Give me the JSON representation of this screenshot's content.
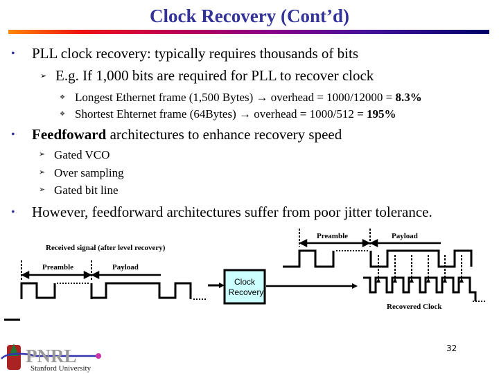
{
  "slide": {
    "title": "Clock Recovery (Cont’d)",
    "page_number": "32"
  },
  "bullets": [
    {
      "text": "PLL clock recovery: typically requires thousands of bits",
      "sub": [
        {
          "text": "E.g. If 1,000 bits are required for PLL to recover clock",
          "sub": [
            {
              "pre": "Longest Ethernet frame (1,500 Bytes) ",
              "arrow": "→",
              "post": " overhead = 1000/12000 = ",
              "bold": "8.3%"
            },
            {
              "pre": "Shortest Ehternet frame (64Bytes) ",
              "arrow": "→",
              "post": " overhead = 1000/512 = ",
              "bold": "195%"
            }
          ]
        }
      ]
    },
    {
      "bold": "Feedfoward",
      "text": " architectures to enhance recovery speed",
      "sub": [
        {
          "text": "Gated VCO"
        },
        {
          "text": "Over sampling"
        },
        {
          "text": "Gated bit line"
        }
      ]
    },
    {
      "text": "However, feedforward architectures suffer from poor jitter tolerance."
    }
  ],
  "icons": {
    "bullet": "•",
    "sub_bullet": "➢",
    "sub_sub_bullet": "❖"
  },
  "diagram": {
    "received_signal_label": "Received signal (after level recovery)",
    "left_preamble_label": "Preamble",
    "left_payload_label": "Payload",
    "block_label_line1": "Clock",
    "block_label_line2": "Recovery",
    "right_preamble_label": "Preamble",
    "right_payload_label": "Payload",
    "recovered_clock_label": "Recovered Clock",
    "block_fill": "#ccffff"
  },
  "logo": {
    "name": "PNRL",
    "subtitle": "Stanford University"
  },
  "colors": {
    "title": "#333399",
    "bullet": "#333399"
  }
}
